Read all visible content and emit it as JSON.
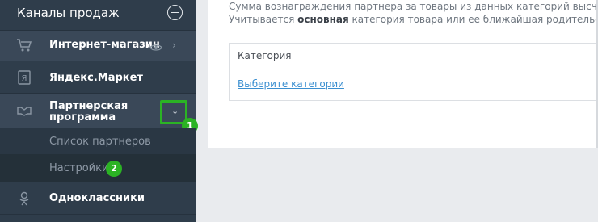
{
  "sidebar": {
    "title": "Каналы продаж",
    "add_icon": "plus-circle-icon",
    "items": [
      {
        "label": "Интернет-магазин",
        "icon": "cart-icon"
      },
      {
        "label": "Яндекс.Маркет",
        "icon": "yandex-icon"
      },
      {
        "label": "Партнерская программа",
        "icon": "handshake-icon"
      },
      {
        "label": "Одноклассники",
        "icon": "odnoklassniki-icon"
      }
    ],
    "subitems": [
      {
        "label": "Список партнеров"
      },
      {
        "label": "Настройки"
      }
    ],
    "badges": [
      "1",
      "2"
    ]
  },
  "main": {
    "desc_line1": "Сумма вознаграждения партнера за товары из данных категорий высчи",
    "desc_line2_pre": "Учитывается ",
    "desc_line2_bold": "основная",
    "desc_line2_post": " категория товара или ее ближайшая родительск",
    "category_header": "Категория",
    "category_link": "Выберите категории"
  },
  "colors": {
    "sidebar_bg": "#2f3d4b",
    "accent_green": "#2bb324",
    "link_blue": "#3b8fd0"
  }
}
